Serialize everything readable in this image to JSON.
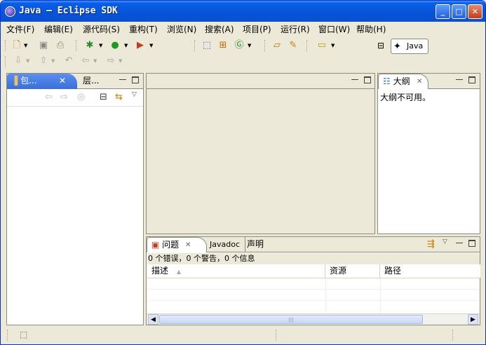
{
  "window": {
    "title": "Java — Eclipse SDK",
    "minimize": "_",
    "maximize": "□",
    "close": "✕"
  },
  "menu": [
    "文件(F)",
    "编辑(E)",
    "源代码(S)",
    "重构(T)",
    "浏览(N)",
    "搜索(A)",
    "项目(P)",
    "运行(R)",
    "窗口(W)",
    "帮助(H)"
  ],
  "perspective": {
    "label": "Java"
  },
  "left_panel": {
    "tab_active": "包...",
    "tab_close": "✕",
    "tab_other": "层..."
  },
  "outline_panel": {
    "tab": "大纲",
    "tab_close": "✕",
    "message": "大纲不可用。"
  },
  "problems_panel": {
    "tabs": [
      "问题",
      "Javadoc",
      "声明"
    ],
    "tab_close": "✕",
    "summary": "0 个错误，0 个警告，0 个信息",
    "columns": [
      "描述",
      "资源",
      "路径"
    ],
    "scroll_thumb": "|||"
  },
  "colors": {
    "title_blue": "#0753d8",
    "tab_blue": "#4a7fe6",
    "chrome": "#ece9d8"
  }
}
